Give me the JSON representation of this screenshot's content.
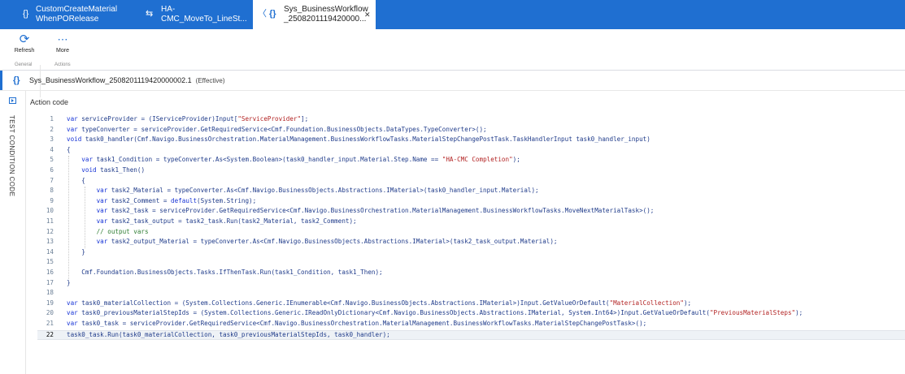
{
  "tabs": [
    {
      "icon": "{}",
      "label_line1": "CustomCreateMaterial",
      "label_line2": "WhenPORelease"
    },
    {
      "icon": "⇆",
      "label_line1": "HA-",
      "label_line2": "CMC_MoveTo_LineSt..."
    },
    {
      "icon": "{}",
      "label_line1": "Sys_BusinessWorkflow",
      "label_line2": "_2508201119420000...",
      "back": "〈",
      "close": "✕"
    }
  ],
  "toolbar": {
    "refresh_label": "Refresh",
    "more_label": "More",
    "group_general": "General",
    "group_actions": "Actions"
  },
  "header": {
    "title": "Sys_BusinessWorkflow_2508201119420000002.1",
    "status": "(Effective)"
  },
  "sidebar": {
    "vertical_label": "TEST CONDITION CODE"
  },
  "content": {
    "title": "Action code"
  },
  "code_lines": [
    {
      "n": "1",
      "text": "var serviceProvider = (IServiceProvider)Input[\"ServiceProvider\"];"
    },
    {
      "n": "2",
      "text": "var typeConverter = serviceProvider.GetRequiredService<Cmf.Foundation.BusinessObjects.DataTypes.TypeConverter>();"
    },
    {
      "n": "3",
      "text": "void task0_handler(Cmf.Navigo.BusinessOrchestration.MaterialManagement.BusinessWorkflowTasks.MaterialStepChangePostTask.TaskHandlerInput task0_handler_input)"
    },
    {
      "n": "4",
      "text": "{"
    },
    {
      "n": "5",
      "text": "    var task1_Condition = typeConverter.As<System.Boolean>(task0_handler_input.Material.Step.Name == \"HA-CMC Completion\");"
    },
    {
      "n": "6",
      "text": "    void task1_Then()"
    },
    {
      "n": "7",
      "text": "    {"
    },
    {
      "n": "8",
      "text": "        var task2_Material = typeConverter.As<Cmf.Navigo.BusinessObjects.Abstractions.IMaterial>(task0_handler_input.Material);"
    },
    {
      "n": "9",
      "text": "        var task2_Comment = default(System.String);"
    },
    {
      "n": "10",
      "text": "        var task2_task = serviceProvider.GetRequiredService<Cmf.Navigo.BusinessOrchestration.MaterialManagement.BusinessWorkflowTasks.MoveNextMaterialTask>();"
    },
    {
      "n": "11",
      "text": "        var task2_task_output = task2_task.Run(task2_Material, task2_Comment);"
    },
    {
      "n": "12",
      "text": "        // output vars"
    },
    {
      "n": "13",
      "text": "        var task2_output_Material = typeConverter.As<Cmf.Navigo.BusinessObjects.Abstractions.IMaterial>(task2_task_output.Material);"
    },
    {
      "n": "14",
      "text": "    }"
    },
    {
      "n": "15",
      "text": ""
    },
    {
      "n": "16",
      "text": "    Cmf.Foundation.BusinessObjects.Tasks.IfThenTask.Run(task1_Condition, task1_Then);"
    },
    {
      "n": "17",
      "text": "}"
    },
    {
      "n": "18",
      "text": ""
    },
    {
      "n": "19",
      "text": "var task0_materialCollection = (System.Collections.Generic.IEnumerable<Cmf.Navigo.BusinessObjects.Abstractions.IMaterial>)Input.GetValueOrDefault(\"MaterialCollection\");"
    },
    {
      "n": "20",
      "text": "var task0_previousMaterialStepIds = (System.Collections.Generic.IReadOnlyDictionary<Cmf.Navigo.BusinessObjects.Abstractions.IMaterial, System.Int64>)Input.GetValueOrDefault(\"PreviousMaterialSteps\");"
    },
    {
      "n": "21",
      "text": "var task0_task = serviceProvider.GetRequiredService<Cmf.Navigo.BusinessOrchestration.MaterialManagement.BusinessWorkflowTasks.MaterialStepChangePostTask>();"
    },
    {
      "n": "22",
      "text": "task0_task.Run(task0_materialCollection, task0_previousMaterialStepIds, task0_handler);"
    }
  ],
  "colors": {
    "accent": "#1f6fd1",
    "keyword": "#1633d6",
    "string": "#b22222",
    "comment": "#2e7d32"
  }
}
